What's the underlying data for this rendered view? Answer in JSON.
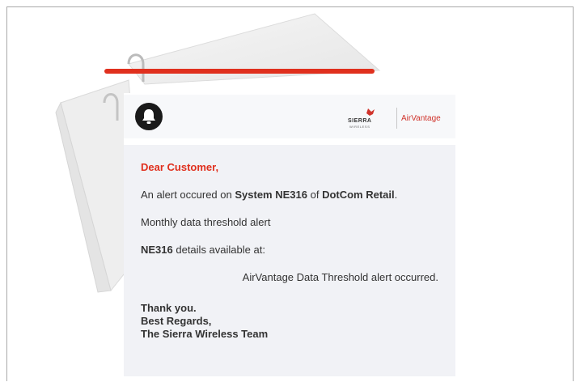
{
  "brand": {
    "logo_name": "SIERRA",
    "logo_sub": "WIRELESS",
    "product": "AirVantage",
    "accent_color": "#e0301e"
  },
  "email": {
    "greeting": "Dear Customer,",
    "alert_prefix": "An alert occured on ",
    "system": "System NE316",
    "alert_mid": " of ",
    "company": "DotCom Retail",
    "alert_end": ".",
    "alert_name": "Monthly data threshold alert",
    "details_device": "NE316",
    "details_suffix": " details available at:",
    "link_text": "AirVantage Data Threshold alert occurred.",
    "thanks": "Thank you.",
    "regards": "Best Regards,",
    "team": "The Sierra Wireless Team"
  },
  "icons": {
    "header_icon": "bell-icon",
    "brand_icon": "sierra-wireless-logo"
  }
}
